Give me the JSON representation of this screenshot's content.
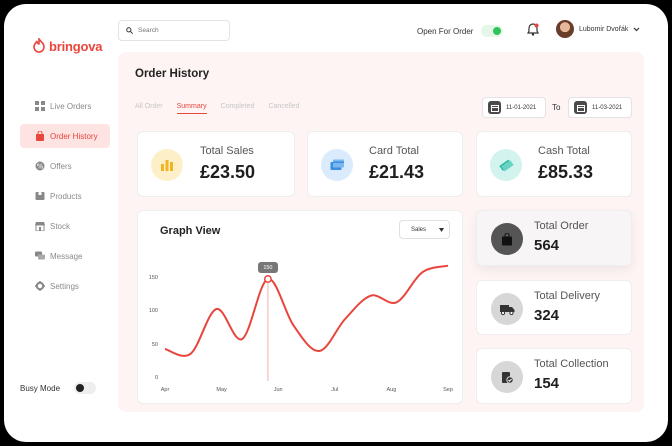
{
  "brand": {
    "name": "bringova",
    "color": "#e8453c"
  },
  "sidebar": {
    "items": [
      {
        "label": "Live Orders",
        "icon": "grid-icon"
      },
      {
        "label": "Order History",
        "icon": "bag-icon",
        "active": true
      },
      {
        "label": "Offers",
        "icon": "tag-icon"
      },
      {
        "label": "Products",
        "icon": "box-icon"
      },
      {
        "label": "Stock",
        "icon": "store-icon"
      },
      {
        "label": "Message",
        "icon": "chat-icon"
      },
      {
        "label": "Settings",
        "icon": "gear-icon"
      }
    ],
    "busy_mode": {
      "label": "Busy Mode",
      "on": false
    }
  },
  "header": {
    "search_placeholder": "Search",
    "open_for_order": {
      "label": "Open For Order",
      "on": true
    },
    "user_name": "Lubomir Dvořák"
  },
  "page": {
    "title": "Order History",
    "tabs": [
      {
        "label": "All Order",
        "active": false
      },
      {
        "label": "Summary",
        "active": true
      },
      {
        "label": "Completed",
        "active": false
      },
      {
        "label": "Cancelled",
        "active": false
      }
    ],
    "date_from": "11-01-2021",
    "to_label": "To",
    "date_to": "11-03-2021"
  },
  "stats": [
    {
      "label": "Total Sales",
      "value": "£23.50",
      "icon": "bar-chart-icon",
      "bg": "#fdf0c8",
      "fg": "#f2b521"
    },
    {
      "label": "Card Total",
      "value": "£21.43",
      "icon": "credit-card-icon",
      "bg": "#d9ebfc",
      "fg": "#3b8fe0"
    },
    {
      "label": "Cash Total",
      "value": "£85.33",
      "icon": "cash-icon",
      "bg": "#d3f3ee",
      "fg": "#24b8a2"
    }
  ],
  "side_stats": [
    {
      "label": "Total Order",
      "value": "564",
      "icon": "shopping-bag-icon"
    },
    {
      "label": "Total Delivery",
      "value": "324",
      "icon": "delivery-truck-icon"
    },
    {
      "label": "Total Collection",
      "value": "154",
      "icon": "collection-icon"
    }
  ],
  "graph": {
    "title": "Graph View",
    "select_value": "Sales",
    "tooltip": "150"
  },
  "chart_data": {
    "type": "line",
    "x": [
      "Apr",
      "",
      "May",
      "",
      "Jun",
      "",
      "Jul",
      "",
      "Aug",
      "",
      "Sep"
    ],
    "yticks": [
      0,
      50,
      100,
      150
    ],
    "ylim": [
      0,
      180
    ],
    "color": "#e8453c",
    "highlight_index": 4,
    "series": [
      {
        "values": [
          45,
          38,
          105,
          60,
          150,
          80,
          42,
          90,
          125,
          115,
          160,
          170
        ]
      }
    ]
  }
}
